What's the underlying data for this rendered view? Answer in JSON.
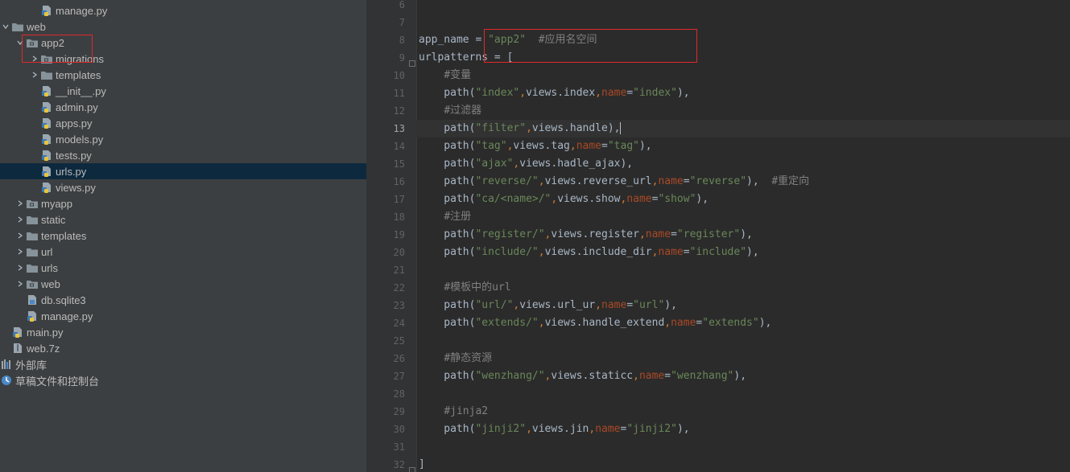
{
  "project_tree": {
    "items": [
      {
        "label": "manage.py",
        "icon": "python-file-icon",
        "arrow": ""
      },
      {
        "label": "web",
        "icon": "folder-icon",
        "arrow": "expanded"
      },
      {
        "label": "app2",
        "icon": "package-folder-icon",
        "arrow": "expanded"
      },
      {
        "label": "migrations",
        "icon": "package-folder-icon",
        "arrow": "collapsed"
      },
      {
        "label": "templates",
        "icon": "folder-icon",
        "arrow": "collapsed"
      },
      {
        "label": "__init__.py",
        "icon": "python-file-icon",
        "arrow": ""
      },
      {
        "label": "admin.py",
        "icon": "python-file-icon",
        "arrow": ""
      },
      {
        "label": "apps.py",
        "icon": "python-file-icon",
        "arrow": ""
      },
      {
        "label": "models.py",
        "icon": "python-file-icon",
        "arrow": ""
      },
      {
        "label": "tests.py",
        "icon": "python-file-icon",
        "arrow": ""
      },
      {
        "label": "urls.py",
        "icon": "python-file-icon",
        "arrow": "",
        "selected": true
      },
      {
        "label": "views.py",
        "icon": "python-file-icon",
        "arrow": ""
      },
      {
        "label": "myapp",
        "icon": "package-folder-icon",
        "arrow": "collapsed"
      },
      {
        "label": "static",
        "icon": "folder-icon",
        "arrow": "collapsed"
      },
      {
        "label": "templates",
        "icon": "folder-icon",
        "arrow": "collapsed"
      },
      {
        "label": "url",
        "icon": "folder-icon",
        "arrow": "collapsed"
      },
      {
        "label": "urls",
        "icon": "folder-icon",
        "arrow": "collapsed"
      },
      {
        "label": "web",
        "icon": "package-folder-icon",
        "arrow": "collapsed"
      },
      {
        "label": "db.sqlite3",
        "icon": "database-file-icon",
        "arrow": ""
      },
      {
        "label": "manage.py",
        "icon": "python-file-icon",
        "arrow": ""
      },
      {
        "label": "main.py",
        "icon": "python-file-icon",
        "arrow": ""
      },
      {
        "label": "web.7z",
        "icon": "archive-file-icon",
        "arrow": ""
      },
      {
        "label": "外部库",
        "icon": "library-icon",
        "arrow": ""
      },
      {
        "label": "草稿文件和控制台",
        "icon": "scratches-icon",
        "arrow": ""
      }
    ]
  },
  "editor": {
    "current_line": 13,
    "lines": [
      {
        "n": "6",
        "tokens": []
      },
      {
        "n": "7",
        "tokens": []
      },
      {
        "n": "8",
        "tokens": [
          {
            "t": "app_name = ",
            "c": ""
          },
          {
            "t": "\"app2\"",
            "c": "str"
          },
          {
            "t": "  ",
            "c": ""
          },
          {
            "t": "#应用名空间",
            "c": "cmt"
          }
        ]
      },
      {
        "n": "9",
        "tokens": [
          {
            "t": "urlpatterns = [",
            "c": ""
          }
        ]
      },
      {
        "n": "10",
        "tokens": [
          {
            "t": "    ",
            "c": ""
          },
          {
            "t": "#变量",
            "c": "cmt"
          }
        ]
      },
      {
        "n": "11",
        "tokens": [
          {
            "t": "    path(",
            "c": ""
          },
          {
            "t": "\"index\"",
            "c": "str"
          },
          {
            "t": ",",
            "c": "op"
          },
          {
            "t": "views.index",
            "c": ""
          },
          {
            "t": ",",
            "c": "op"
          },
          {
            "t": "name",
            "c": "kw"
          },
          {
            "t": "=",
            "c": ""
          },
          {
            "t": "\"index\"",
            "c": "str"
          },
          {
            "t": "),",
            "c": ""
          }
        ]
      },
      {
        "n": "12",
        "tokens": [
          {
            "t": "    ",
            "c": ""
          },
          {
            "t": "#过滤器",
            "c": "cmt"
          }
        ]
      },
      {
        "n": "13",
        "tokens": [
          {
            "t": "    path(",
            "c": ""
          },
          {
            "t": "\"filter\"",
            "c": "str"
          },
          {
            "t": ",",
            "c": "op"
          },
          {
            "t": "views.handle),",
            "c": ""
          }
        ]
      },
      {
        "n": "14",
        "tokens": [
          {
            "t": "    path(",
            "c": ""
          },
          {
            "t": "\"tag\"",
            "c": "str"
          },
          {
            "t": ",",
            "c": "op"
          },
          {
            "t": "views.tag",
            "c": ""
          },
          {
            "t": ",",
            "c": "op"
          },
          {
            "t": "name",
            "c": "kw"
          },
          {
            "t": "=",
            "c": ""
          },
          {
            "t": "\"tag\"",
            "c": "str"
          },
          {
            "t": "),",
            "c": ""
          }
        ]
      },
      {
        "n": "15",
        "tokens": [
          {
            "t": "    path(",
            "c": ""
          },
          {
            "t": "\"ajax\"",
            "c": "str"
          },
          {
            "t": ",",
            "c": "op"
          },
          {
            "t": "views.hadle_ajax),",
            "c": ""
          }
        ]
      },
      {
        "n": "16",
        "tokens": [
          {
            "t": "    path(",
            "c": ""
          },
          {
            "t": "\"reverse/\"",
            "c": "str"
          },
          {
            "t": ",",
            "c": "op"
          },
          {
            "t": "views.reverse_url",
            "c": ""
          },
          {
            "t": ",",
            "c": "op"
          },
          {
            "t": "name",
            "c": "kw"
          },
          {
            "t": "=",
            "c": ""
          },
          {
            "t": "\"reverse\"",
            "c": "str"
          },
          {
            "t": "),  ",
            "c": ""
          },
          {
            "t": "#重定向",
            "c": "cmt"
          }
        ]
      },
      {
        "n": "17",
        "tokens": [
          {
            "t": "    path(",
            "c": ""
          },
          {
            "t": "\"ca/<name>/\"",
            "c": "str"
          },
          {
            "t": ",",
            "c": "op"
          },
          {
            "t": "views.show",
            "c": ""
          },
          {
            "t": ",",
            "c": "op"
          },
          {
            "t": "name",
            "c": "kw"
          },
          {
            "t": "=",
            "c": ""
          },
          {
            "t": "\"show\"",
            "c": "str"
          },
          {
            "t": "),",
            "c": ""
          }
        ]
      },
      {
        "n": "18",
        "tokens": [
          {
            "t": "    ",
            "c": ""
          },
          {
            "t": "#注册",
            "c": "cmt"
          }
        ]
      },
      {
        "n": "19",
        "tokens": [
          {
            "t": "    path(",
            "c": ""
          },
          {
            "t": "\"register/\"",
            "c": "str"
          },
          {
            "t": ",",
            "c": "op"
          },
          {
            "t": "views.register",
            "c": ""
          },
          {
            "t": ",",
            "c": "op"
          },
          {
            "t": "name",
            "c": "kw"
          },
          {
            "t": "=",
            "c": ""
          },
          {
            "t": "\"register\"",
            "c": "str"
          },
          {
            "t": "),",
            "c": ""
          }
        ]
      },
      {
        "n": "20",
        "tokens": [
          {
            "t": "    path(",
            "c": ""
          },
          {
            "t": "\"include/\"",
            "c": "str"
          },
          {
            "t": ",",
            "c": "op"
          },
          {
            "t": "views.include_dir",
            "c": ""
          },
          {
            "t": ",",
            "c": "op"
          },
          {
            "t": "name",
            "c": "kw"
          },
          {
            "t": "=",
            "c": ""
          },
          {
            "t": "\"include\"",
            "c": "str"
          },
          {
            "t": "),",
            "c": ""
          }
        ]
      },
      {
        "n": "21",
        "tokens": []
      },
      {
        "n": "22",
        "tokens": [
          {
            "t": "    ",
            "c": ""
          },
          {
            "t": "#模板中的url",
            "c": "cmt"
          }
        ]
      },
      {
        "n": "23",
        "tokens": [
          {
            "t": "    path(",
            "c": ""
          },
          {
            "t": "\"url/\"",
            "c": "str"
          },
          {
            "t": ",",
            "c": "op"
          },
          {
            "t": "views.url_ur",
            "c": ""
          },
          {
            "t": ",",
            "c": "op"
          },
          {
            "t": "name",
            "c": "kw"
          },
          {
            "t": "=",
            "c": ""
          },
          {
            "t": "\"url\"",
            "c": "str"
          },
          {
            "t": "),",
            "c": ""
          }
        ]
      },
      {
        "n": "24",
        "tokens": [
          {
            "t": "    path(",
            "c": ""
          },
          {
            "t": "\"extends/\"",
            "c": "str"
          },
          {
            "t": ",",
            "c": "op"
          },
          {
            "t": "views.handle_extend",
            "c": ""
          },
          {
            "t": ",",
            "c": "op"
          },
          {
            "t": "name",
            "c": "kw"
          },
          {
            "t": "=",
            "c": ""
          },
          {
            "t": "\"extends\"",
            "c": "str"
          },
          {
            "t": "),",
            "c": ""
          }
        ]
      },
      {
        "n": "25",
        "tokens": []
      },
      {
        "n": "26",
        "tokens": [
          {
            "t": "    ",
            "c": ""
          },
          {
            "t": "#静态资源",
            "c": "cmt"
          }
        ]
      },
      {
        "n": "27",
        "tokens": [
          {
            "t": "    path(",
            "c": ""
          },
          {
            "t": "\"wenzhang/\"",
            "c": "str"
          },
          {
            "t": ",",
            "c": "op"
          },
          {
            "t": "views.staticc",
            "c": ""
          },
          {
            "t": ",",
            "c": "op"
          },
          {
            "t": "name",
            "c": "kw"
          },
          {
            "t": "=",
            "c": ""
          },
          {
            "t": "\"wenzhang\"",
            "c": "str"
          },
          {
            "t": "),",
            "c": ""
          }
        ]
      },
      {
        "n": "28",
        "tokens": []
      },
      {
        "n": "29",
        "tokens": [
          {
            "t": "    ",
            "c": ""
          },
          {
            "t": "#jinja2",
            "c": "cmt"
          }
        ]
      },
      {
        "n": "30",
        "tokens": [
          {
            "t": "    path(",
            "c": ""
          },
          {
            "t": "\"jinji2\"",
            "c": "str"
          },
          {
            "t": ",",
            "c": "op"
          },
          {
            "t": "views.jin",
            "c": ""
          },
          {
            "t": ",",
            "c": "op"
          },
          {
            "t": "name",
            "c": "kw"
          },
          {
            "t": "=",
            "c": ""
          },
          {
            "t": "\"jinji2\"",
            "c": "str"
          },
          {
            "t": "),",
            "c": ""
          }
        ]
      },
      {
        "n": "31",
        "tokens": []
      },
      {
        "n": "32",
        "tokens": [
          {
            "t": "]",
            "c": ""
          }
        ]
      }
    ]
  },
  "colors": {
    "tree_bg": "#3c3f41",
    "editor_bg": "#2b2b2b",
    "selection": "#0d293e",
    "string": "#6a8759",
    "keyword_arg": "#aa4926",
    "comment": "#808080",
    "highlight_box": "#e0282c"
  }
}
